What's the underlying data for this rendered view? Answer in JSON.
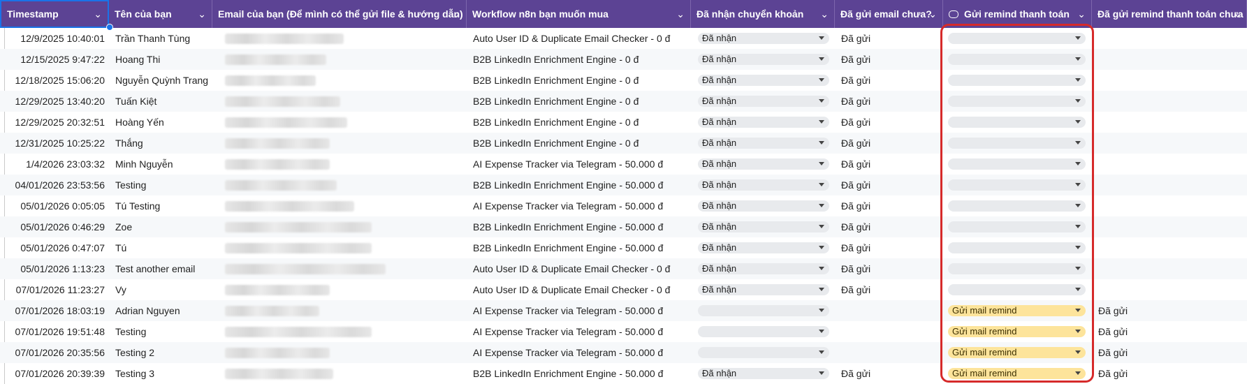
{
  "header": {
    "columns": [
      {
        "label": "Timestamp"
      },
      {
        "label": "Tên của bạn"
      },
      {
        "label": "Email của bạn (Để mình có thể gửi file & hướng dẫn)"
      },
      {
        "label": "Workflow n8n bạn muốn mua"
      },
      {
        "label": "Đã nhận chuyển khoản"
      },
      {
        "label": "Đã gửi email chưa?"
      },
      {
        "label": "Gửi remind thanh toán"
      },
      {
        "label": "Đã gửi remind thanh toán chưa"
      }
    ],
    "chevron": "⌄"
  },
  "rows": [
    {
      "timestamp": "12/9/2025 10:40:01",
      "name": "Trần Thanh Tùng",
      "workflow": "Auto User ID & Duplicate Email Checker - 0 đ",
      "payment": "Đã nhận",
      "email_sent": "Đã gửi",
      "remind": "",
      "remind_sent": ""
    },
    {
      "timestamp": "12/15/2025 9:47:22",
      "name": "Hoang Thi",
      "workflow": "B2B LinkedIn Enrichment Engine - 0 đ",
      "payment": "Đã nhận",
      "email_sent": "Đã gửi",
      "remind": "",
      "remind_sent": ""
    },
    {
      "timestamp": "12/18/2025 15:06:20",
      "name": "Nguyễn Quỳnh Trang",
      "workflow": "B2B LinkedIn Enrichment Engine - 0 đ",
      "payment": "Đã nhận",
      "email_sent": "Đã gửi",
      "remind": "",
      "remind_sent": ""
    },
    {
      "timestamp": "12/29/2025 13:40:20",
      "name": "Tuấn Kiệt",
      "workflow": "B2B LinkedIn Enrichment Engine - 0 đ",
      "payment": "Đã nhận",
      "email_sent": "Đã gửi",
      "remind": "",
      "remind_sent": ""
    },
    {
      "timestamp": "12/29/2025 20:32:51",
      "name": "Hoàng Yến",
      "workflow": "B2B LinkedIn Enrichment Engine - 0 đ",
      "payment": "Đã nhận",
      "email_sent": "Đã gửi",
      "remind": "",
      "remind_sent": ""
    },
    {
      "timestamp": "12/31/2025 10:25:22",
      "name": "Thắng",
      "workflow": "B2B LinkedIn Enrichment Engine - 0 đ",
      "payment": "Đã nhận",
      "email_sent": "Đã gửi",
      "remind": "",
      "remind_sent": ""
    },
    {
      "timestamp": "1/4/2026 23:03:32",
      "name": "Minh Nguyễn",
      "workflow": "AI Expense Tracker via Telegram - 50.000 đ",
      "payment": "Đã nhận",
      "email_sent": "Đã gửi",
      "remind": "",
      "remind_sent": ""
    },
    {
      "timestamp": "04/01/2026 23:53:56",
      "name": "Testing",
      "workflow": "B2B LinkedIn Enrichment Engine - 50.000 đ",
      "payment": "Đã nhận",
      "email_sent": "Đã gửi",
      "remind": "",
      "remind_sent": ""
    },
    {
      "timestamp": "05/01/2026 0:05:05",
      "name": "Tú Testing",
      "workflow": "AI Expense Tracker via Telegram - 50.000 đ",
      "payment": "Đã nhận",
      "email_sent": "Đã gửi",
      "remind": "",
      "remind_sent": ""
    },
    {
      "timestamp": "05/01/2026 0:46:29",
      "name": "Zoe",
      "workflow": "B2B LinkedIn Enrichment Engine - 50.000 đ",
      "payment": "Đã nhận",
      "email_sent": "Đã gửi",
      "remind": "",
      "remind_sent": ""
    },
    {
      "timestamp": "05/01/2026 0:47:07",
      "name": "Tú",
      "workflow": "B2B LinkedIn Enrichment Engine - 50.000 đ",
      "payment": "Đã nhận",
      "email_sent": "Đã gửi",
      "remind": "",
      "remind_sent": ""
    },
    {
      "timestamp": "05/01/2026 1:13:23",
      "name": "Test another email",
      "workflow": "Auto User ID & Duplicate Email Checker - 0 đ",
      "payment": "Đã nhận",
      "email_sent": "Đã gửi",
      "remind": "",
      "remind_sent": ""
    },
    {
      "timestamp": "07/01/2026 11:23:27",
      "name": "Vy",
      "workflow": "Auto User ID & Duplicate Email Checker - 0 đ",
      "payment": "Đã nhận",
      "email_sent": "Đã gửi",
      "remind": "",
      "remind_sent": ""
    },
    {
      "timestamp": "07/01/2026 18:03:19",
      "name": "Adrian Nguyen",
      "workflow": "AI Expense Tracker via Telegram - 50.000 đ",
      "payment": "",
      "email_sent": "",
      "remind": "Gửi mail remind",
      "remind_sent": "Đã gửi"
    },
    {
      "timestamp": "07/01/2026 19:51:48",
      "name": "Testing",
      "workflow": "AI Expense Tracker via Telegram - 50.000 đ",
      "payment": "",
      "email_sent": "",
      "remind": "Gửi mail remind",
      "remind_sent": "Đã gửi"
    },
    {
      "timestamp": "07/01/2026 20:35:56",
      "name": "Testing 2",
      "workflow": "AI Expense Tracker via Telegram - 50.000 đ",
      "payment": "",
      "email_sent": "",
      "remind": "Gửi mail remind",
      "remind_sent": "Đã gửi"
    },
    {
      "timestamp": "07/01/2026 20:39:39",
      "name": "Testing 3",
      "workflow": "B2B LinkedIn Enrichment Engine - 50.000 đ",
      "payment": "Đã nhận",
      "email_sent": "Đã gửi",
      "remind": "Gửi mail remind",
      "remind_sent": "Đã gửi"
    }
  ],
  "colors": {
    "header_bg": "#5c4394",
    "remind_chip": "#fde49b",
    "highlight": "#d62a2a",
    "selection": "#1a73e8"
  }
}
